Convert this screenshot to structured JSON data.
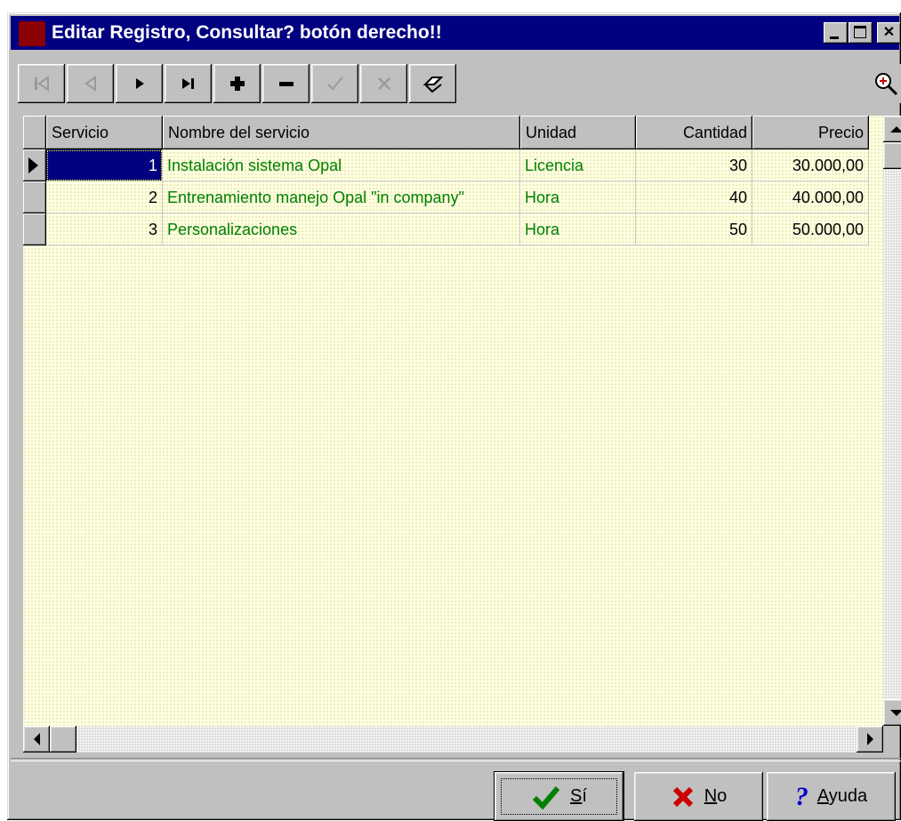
{
  "window": {
    "title": "Editar Registro, Consultar? botón derecho!!"
  },
  "toolbar": {
    "buttons": [
      {
        "name": "first-record",
        "icon": "skip-first-icon",
        "enabled": false
      },
      {
        "name": "prior-record",
        "icon": "prior-icon",
        "enabled": false
      },
      {
        "name": "next-record",
        "icon": "next-icon",
        "enabled": true
      },
      {
        "name": "last-record",
        "icon": "skip-last-icon",
        "enabled": true
      },
      {
        "name": "insert-record",
        "icon": "plus-icon",
        "enabled": true
      },
      {
        "name": "delete-record",
        "icon": "minus-icon",
        "enabled": true
      },
      {
        "name": "post-record",
        "icon": "check-icon",
        "enabled": false
      },
      {
        "name": "cancel-record",
        "icon": "x-icon",
        "enabled": false
      },
      {
        "name": "refresh-record",
        "icon": "refresh-icon",
        "enabled": true
      }
    ],
    "zoom_icon": "zoom-in-icon"
  },
  "grid": {
    "columns": [
      "Servicio",
      "Nombre del servicio",
      "Unidad",
      "Cantidad",
      "Precio"
    ],
    "rows": [
      {
        "servicio": "1",
        "nombre": "Instalación sistema Opal",
        "unidad": "Licencia",
        "cantidad": "30",
        "precio": "30.000,00"
      },
      {
        "servicio": "2",
        "nombre": "Entrenamiento manejo Opal \"in company\"",
        "unidad": "Hora",
        "cantidad": "40",
        "precio": "40.000,00"
      },
      {
        "servicio": "3",
        "nombre": "Personalizaciones",
        "unidad": "Hora",
        "cantidad": "50",
        "precio": "50.000,00"
      }
    ],
    "colors": {
      "text": "#008000",
      "background": "#ffffe4",
      "selection": "#000080"
    }
  },
  "buttons": {
    "si_prefix": "",
    "si_key": "S",
    "si_rest": "í",
    "no_key": "N",
    "no_rest": "o",
    "ayuda_key": "A",
    "ayuda_rest": "yuda"
  }
}
